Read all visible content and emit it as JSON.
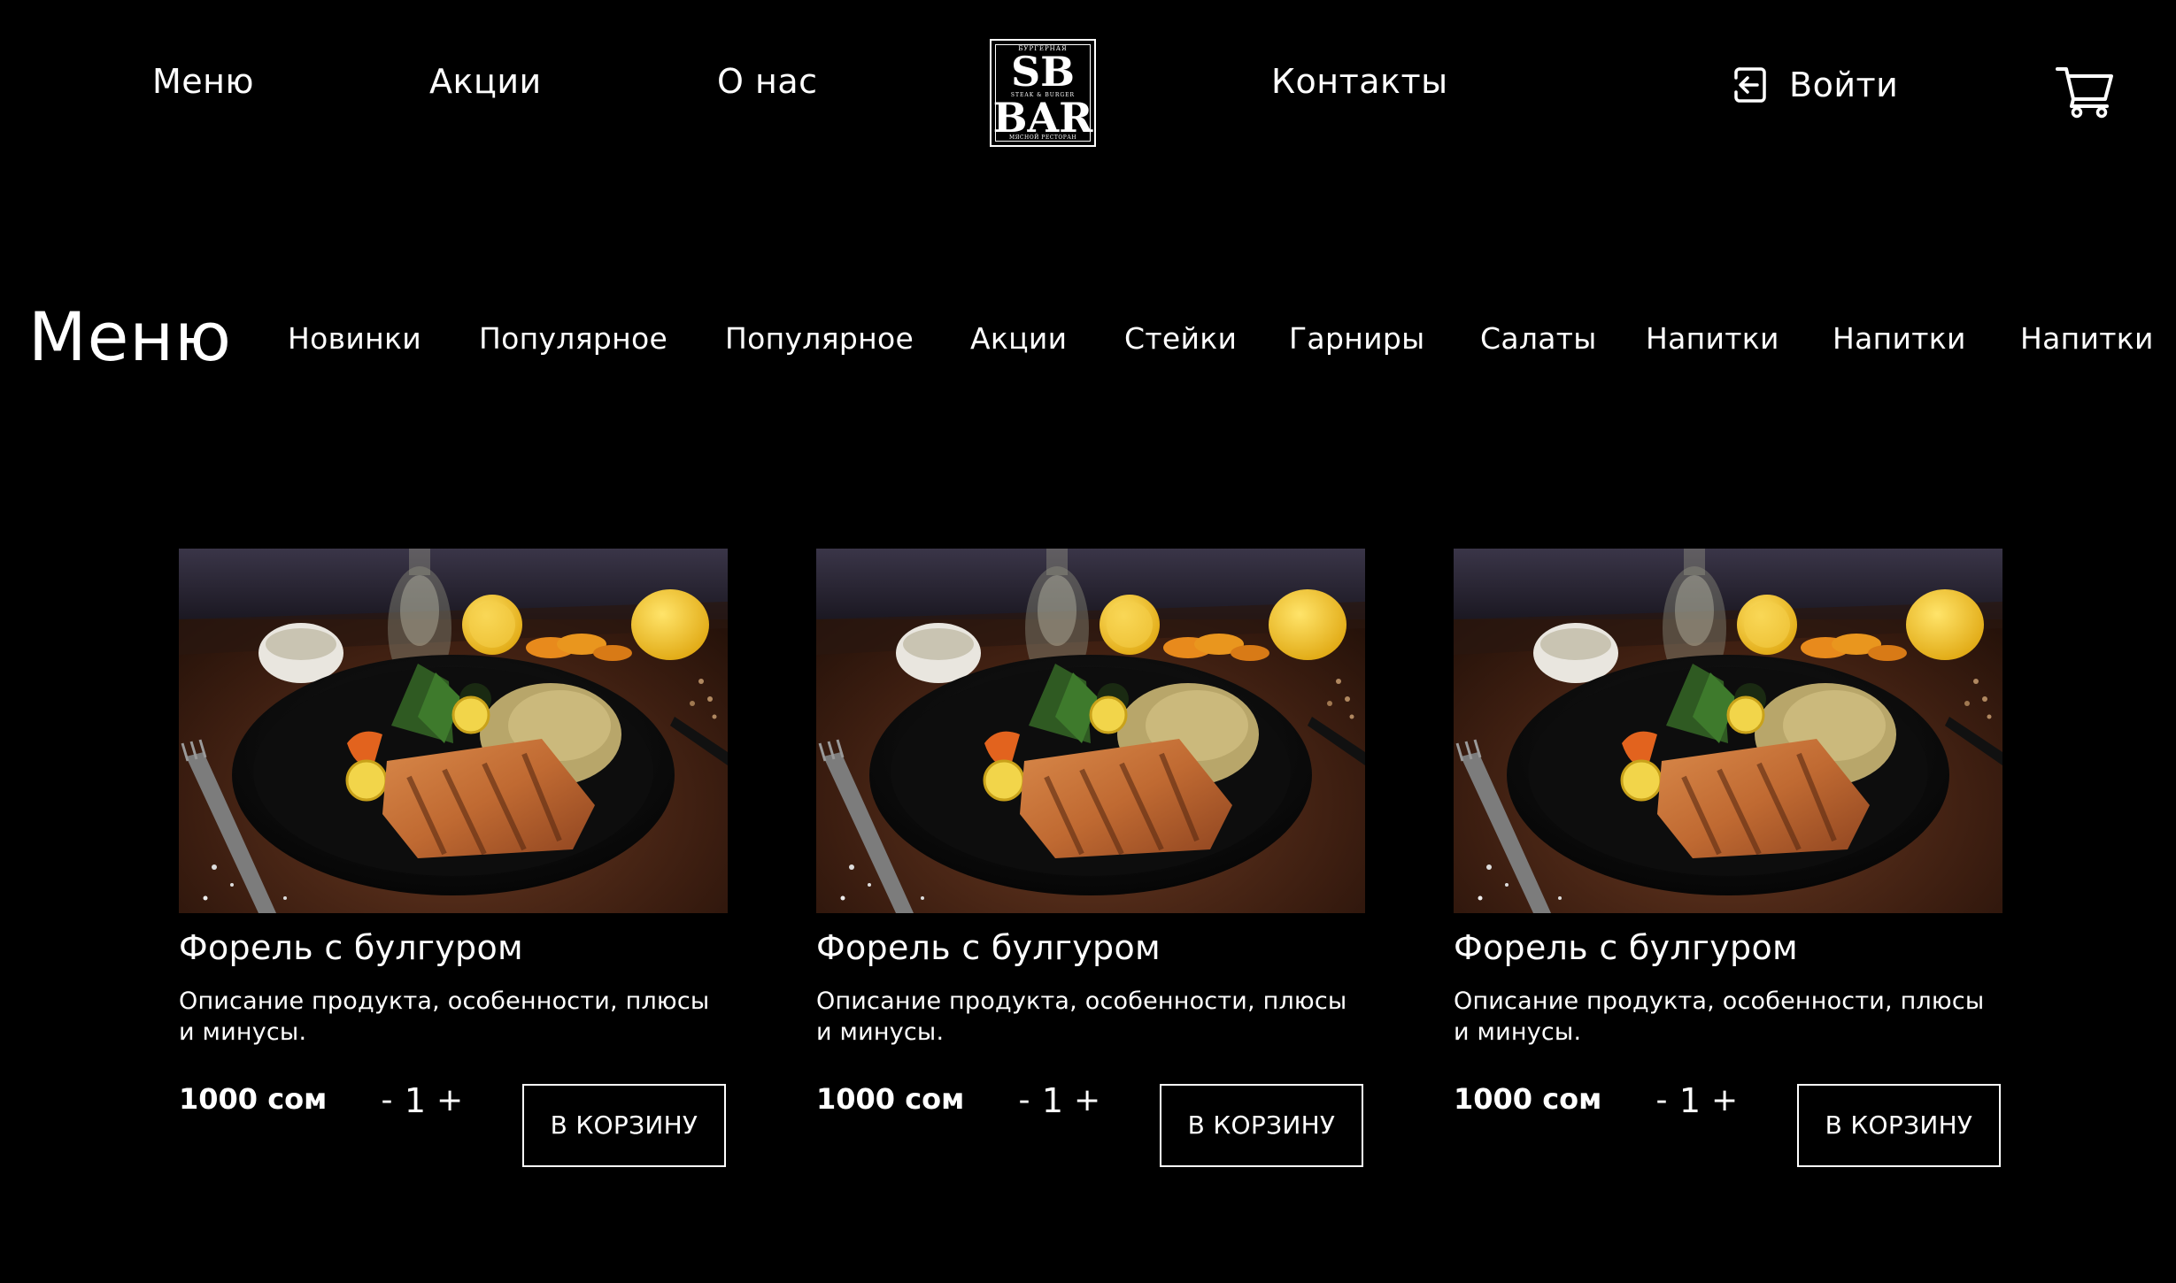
{
  "header": {
    "nav": {
      "menu": "Меню",
      "promotions": "Акции",
      "about": "О нас",
      "contacts": "Контакты"
    },
    "logo": {
      "top_text": "БУРГЕРНАЯ",
      "line1": "SB",
      "subline": "STEAK & BURGER",
      "line2": "BAR",
      "bottom_text": "МЯСНОЙ РЕСТОРАН"
    },
    "login_label": "Войти",
    "login_icon": "login-arrow-icon",
    "cart_icon": "shopping-cart-icon"
  },
  "menu_section": {
    "heading": "Меню",
    "categories": [
      "Новинки",
      "Популярное",
      "Популярное",
      "Акции",
      "Стейки",
      "Гарниры",
      "Салаты",
      "Напитки",
      "Напитки",
      "Напитки"
    ]
  },
  "products": [
    {
      "title": "Форель с булгуром",
      "description": "Описание продукта, особенности, плюсы и минусы.",
      "price": "1000 сом",
      "qty_minus": "-",
      "quantity": "1",
      "qty_plus": "+",
      "button": "В КОРЗИНУ"
    },
    {
      "title": "Форель с булгуром",
      "description": "Описание продукта, особенности, плюсы и минусы.",
      "price": "1000 сом",
      "qty_minus": "-",
      "quantity": "1",
      "qty_plus": "+",
      "button": "В КОРЗИНУ"
    },
    {
      "title": "Форель с булгуром",
      "description": "Описание продукта, особенности, плюсы и минусы.",
      "price": "1000 сом",
      "qty_minus": "-",
      "quantity": "1",
      "qty_plus": "+",
      "button": "В КОРЗИНУ"
    }
  ],
  "colors": {
    "background": "#000000",
    "text": "#ffffff"
  }
}
